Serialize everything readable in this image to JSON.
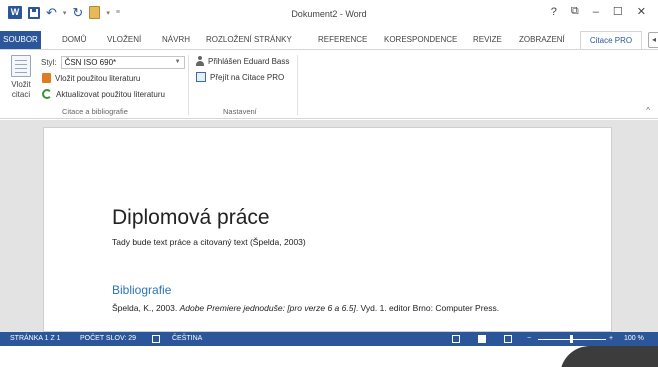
{
  "window": {
    "title": "Dokument2 - Word",
    "controls": [
      "?",
      "⧉",
      "–",
      "☐",
      "✕"
    ]
  },
  "qat": {
    "app_icon": "W",
    "icons": [
      "save-icon",
      "undo-icon",
      "redo-icon",
      "paste-icon"
    ]
  },
  "tabs": [
    {
      "label": "SOUBOR"
    },
    {
      "label": "DOMŮ"
    },
    {
      "label": "VLOŽENÍ"
    },
    {
      "label": "NÁVRH"
    },
    {
      "label": "ROZLOŽENÍ STRÁNKY"
    },
    {
      "label": "REFERENCE"
    },
    {
      "label": "KORESPONDENCE"
    },
    {
      "label": "REVIZE"
    },
    {
      "label": "ZOBRAZENÍ"
    },
    {
      "label": "Citace PRO"
    }
  ],
  "ribbon": {
    "insert_label_1": "Vložit",
    "insert_label_2": "citaci",
    "style_label": "Styl:",
    "style_value": "ČSN ISO 690*",
    "insert_used": "Vložit použitou literaturu",
    "update_used": "Aktualizovat použitou literaturu",
    "group1_label": "Citace a bibliografie",
    "logged_in": "Přihlášen Eduard Bass",
    "goto_citace": "Přejít na Citace PRO",
    "group2_label": "Nastavení"
  },
  "document": {
    "heading": "Diplomová práce",
    "body": "Tady bude text práce a citovaný text (Špelda, 2003)",
    "bib_heading": "Bibliografie",
    "ref_author": "Špelda, K., 2003. ",
    "ref_title": "Adobe Premiere jednoduše: [pro verze 6 a 6.5]",
    "ref_rest": ". Vyd. 1. editor Brno: Computer Press."
  },
  "status": {
    "page": "STRÁNKA 1 Z 1",
    "words": "POČET SLOV: 29",
    "language": "ČEŠTINA",
    "zoom": "100 %",
    "zoom_minus": "−",
    "zoom_plus": "+"
  },
  "colors": {
    "accent": "#2b579a",
    "heading2": "#2e74b5"
  }
}
